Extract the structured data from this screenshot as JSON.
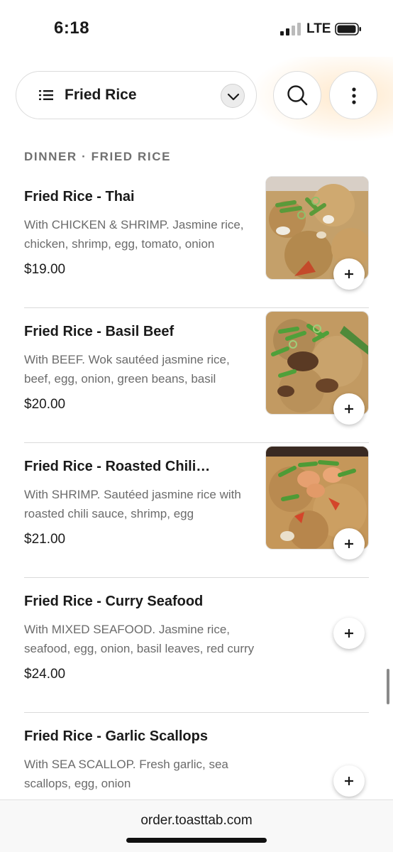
{
  "status_bar": {
    "time": "6:18",
    "network": "LTE",
    "signal_bars_active": 2,
    "signal_bars_total": 4,
    "battery_level": 0.9
  },
  "nav": {
    "category": "Fried Rice",
    "icons": {
      "list": "list-icon",
      "chevron": "chevron-down-icon",
      "search": "search-icon",
      "more": "more-vertical-icon"
    }
  },
  "section_heading": "DINNER · FRIED RICE",
  "items": [
    {
      "name": "Fried Rice - Thai",
      "description": "With CHICKEN & SHRIMP. Jasmine rice, chicken, shrimp, egg, tomato, onion",
      "price": "$19.00",
      "has_photo": true
    },
    {
      "name": "Fried Rice - Basil Beef",
      "description": "With BEEF. Wok sautéed jasmine rice, beef, egg, onion, green beans, basil",
      "price": "$20.00",
      "has_photo": true
    },
    {
      "name": "Fried Rice - Roasted Chili…",
      "description": "With SHRIMP. Sautéed jasmine rice with roasted chili sauce, shrimp, egg",
      "price": "$21.00",
      "has_photo": true
    },
    {
      "name": "Fried Rice - Curry Seafood",
      "description": "With MIXED SEAFOOD. Jasmine rice, seafood, egg, onion, basil leaves, red curry",
      "price": "$24.00",
      "has_photo": false
    },
    {
      "name": "Fried Rice - Garlic Scallops",
      "description": "With SEA SCALLOP. Fresh garlic, sea scallops, egg, onion",
      "price": "",
      "has_photo": false
    }
  ],
  "add_label_icon": "plus-icon",
  "browser": {
    "url": "order.toasttab.com"
  }
}
